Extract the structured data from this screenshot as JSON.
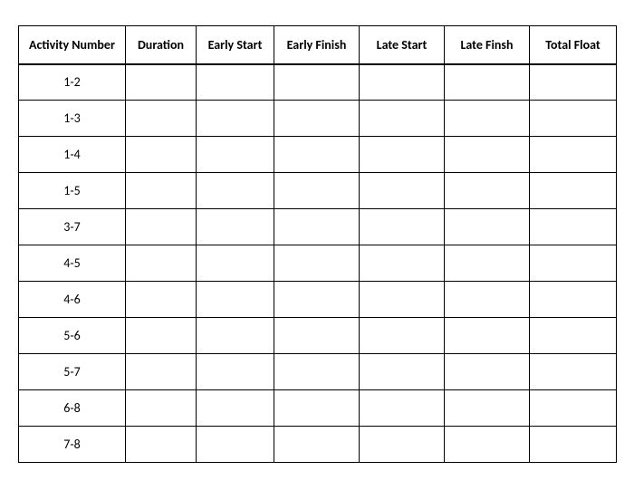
{
  "chart_data": {
    "type": "table",
    "columns": [
      "Activity Number",
      "Duration",
      "Early Start",
      "Early Finish",
      "Late Start",
      "Late Finsh",
      "Total Float"
    ],
    "rows": [
      {
        "activity": "1-2",
        "duration": "",
        "early_start": "",
        "early_finish": "",
        "late_start": "",
        "late_finish": "",
        "total_float": ""
      },
      {
        "activity": "1-3",
        "duration": "",
        "early_start": "",
        "early_finish": "",
        "late_start": "",
        "late_finish": "",
        "total_float": ""
      },
      {
        "activity": "1-4",
        "duration": "",
        "early_start": "",
        "early_finish": "",
        "late_start": "",
        "late_finish": "",
        "total_float": ""
      },
      {
        "activity": "1-5",
        "duration": "",
        "early_start": "",
        "early_finish": "",
        "late_start": "",
        "late_finish": "",
        "total_float": ""
      },
      {
        "activity": "3-7",
        "duration": "",
        "early_start": "",
        "early_finish": "",
        "late_start": "",
        "late_finish": "",
        "total_float": ""
      },
      {
        "activity": "4-5",
        "duration": "",
        "early_start": "",
        "early_finish": "",
        "late_start": "",
        "late_finish": "",
        "total_float": ""
      },
      {
        "activity": "4-6",
        "duration": "",
        "early_start": "",
        "early_finish": "",
        "late_start": "",
        "late_finish": "",
        "total_float": ""
      },
      {
        "activity": "5-6",
        "duration": "",
        "early_start": "",
        "early_finish": "",
        "late_start": "",
        "late_finish": "",
        "total_float": ""
      },
      {
        "activity": "5-7",
        "duration": "",
        "early_start": "",
        "early_finish": "",
        "late_start": "",
        "late_finish": "",
        "total_float": ""
      },
      {
        "activity": "6-8",
        "duration": "",
        "early_start": "",
        "early_finish": "",
        "late_start": "",
        "late_finish": "",
        "total_float": ""
      },
      {
        "activity": "7-8",
        "duration": "",
        "early_start": "",
        "early_finish": "",
        "late_start": "",
        "late_finish": "",
        "total_float": ""
      }
    ]
  }
}
